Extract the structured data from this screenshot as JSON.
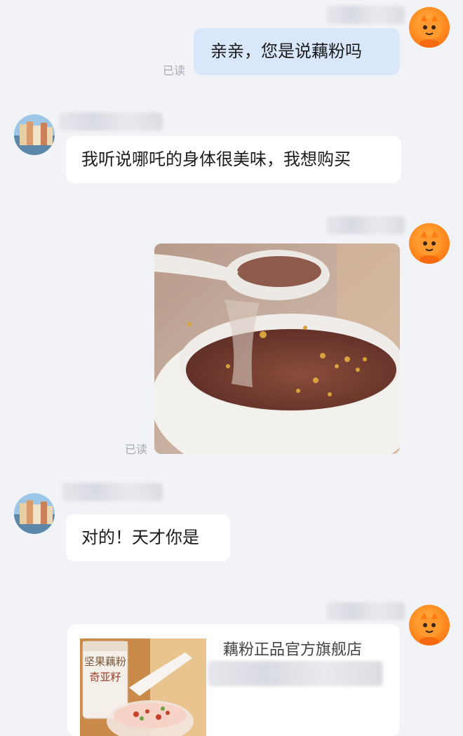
{
  "messages": [
    {
      "side": "out",
      "type": "text",
      "text": "亲亲，您是说藕粉吗",
      "read_status": "已读"
    },
    {
      "side": "in",
      "type": "text",
      "text": "我听说哪吒的身体很美味，我想购买"
    },
    {
      "side": "out",
      "type": "image",
      "read_status": "已读"
    },
    {
      "side": "in",
      "type": "text",
      "text": "对的！天才你是"
    },
    {
      "side": "out",
      "type": "product-card",
      "store_name": "藕粉正品官方旗舰店",
      "package_label": "坚果藕粉",
      "package_sublabel": "奇亚籽"
    }
  ],
  "colors": {
    "background": "#f2f3f7",
    "outgoing_bubble": "#d9e7fb",
    "incoming_bubble": "#ffffff",
    "read_status": "#a8abb4",
    "bot_avatar": "#ff8a1f"
  },
  "icons": [
    "bot-avatar-icon",
    "user-avatar-icon"
  ]
}
